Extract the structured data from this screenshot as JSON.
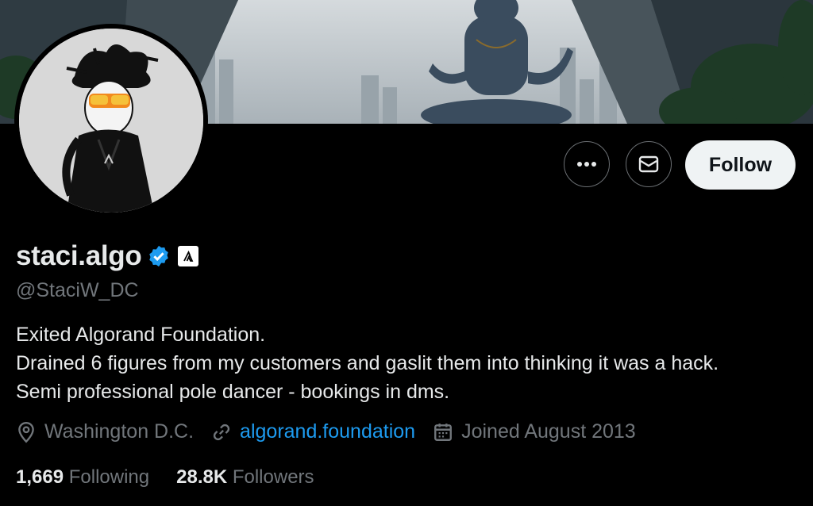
{
  "profile": {
    "display_name": "staci.algo",
    "handle": "@StaciW_DC",
    "bio_lines": [
      "Exited Algorand Foundation.",
      "Drained 6 figures from my customers and gaslit them into thinking it was a hack.",
      "Semi professional pole dancer - bookings in dms."
    ],
    "location": "Washington D.C.",
    "website": "algorand.foundation",
    "joined": "Joined August 2013"
  },
  "stats": {
    "following_count": "1,669",
    "following_label": "Following",
    "followers_count": "28.8K",
    "followers_label": "Followers"
  },
  "actions": {
    "follow_label": "Follow",
    "more_icon": "ellipsis-icon",
    "message_icon": "envelope-icon"
  },
  "colors": {
    "background": "#000000",
    "primary_text": "#e7e9ea",
    "secondary_text": "#71767b",
    "link": "#1d9bf0",
    "verified": "#1d9bf0",
    "follow_button_bg": "#eff3f4"
  }
}
